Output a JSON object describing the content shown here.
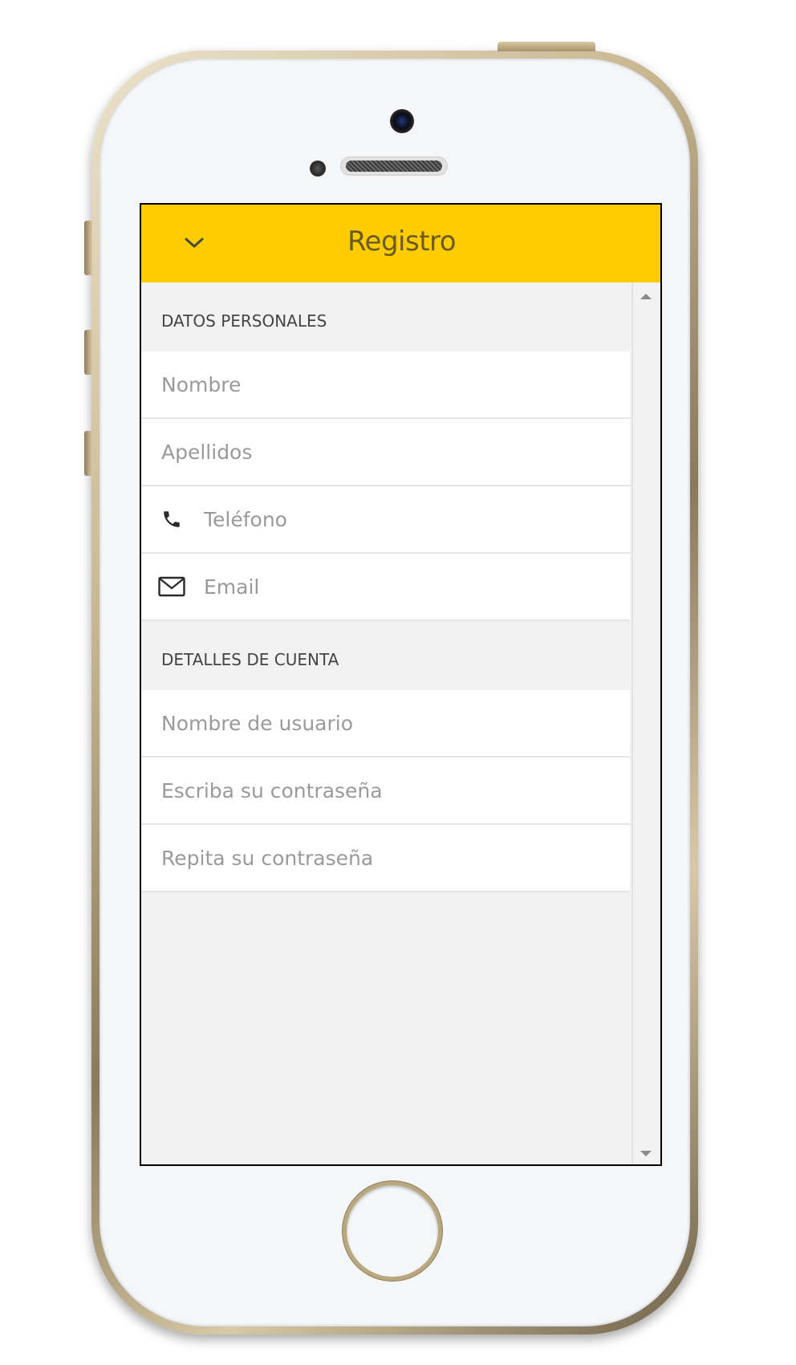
{
  "header": {
    "title": "Registro",
    "back_icon": "chevron-down-icon",
    "background_color": "#ffcc00",
    "title_color": "#6b5a22"
  },
  "sections": {
    "personal": {
      "title": "DATOS PERSONALES",
      "fields": {
        "first_name": {
          "placeholder": "Nombre",
          "value": ""
        },
        "last_name": {
          "placeholder": "Apellidos",
          "value": ""
        },
        "phone": {
          "placeholder": "Teléfono",
          "value": "",
          "icon": "phone-icon"
        },
        "email": {
          "placeholder": "Email",
          "value": "",
          "icon": "envelope-icon"
        }
      }
    },
    "account": {
      "title": "DETALLES DE CUENTA",
      "fields": {
        "username": {
          "placeholder": "Nombre de usuario",
          "value": ""
        },
        "password": {
          "placeholder": "Escriba su contraseña",
          "value": ""
        },
        "password_repeat": {
          "placeholder": "Repita su contraseña",
          "value": ""
        }
      }
    }
  }
}
